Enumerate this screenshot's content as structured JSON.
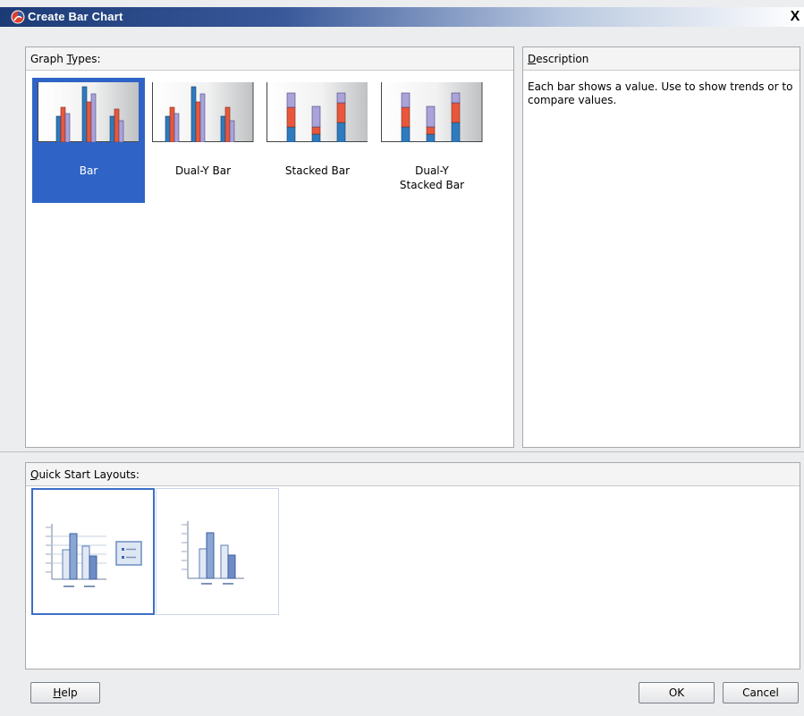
{
  "window": {
    "title": "Create Bar Chart",
    "close_glyph": "X"
  },
  "graph_types": {
    "header": "Graph Types:",
    "mnemonic": "T",
    "items": [
      {
        "label": "Bar",
        "selected": true
      },
      {
        "label": "Dual-Y Bar",
        "selected": false
      },
      {
        "label": "Stacked Bar",
        "selected": false
      },
      {
        "label": "Dual-Y Stacked Bar",
        "selected": false
      }
    ]
  },
  "description": {
    "header": "Description",
    "mnemonic": "D",
    "text": "Each bar shows a value. Use to show trends or to compare values."
  },
  "quick_start": {
    "header": "Quick Start Layouts:",
    "mnemonic": "Q",
    "items": [
      {
        "name": "layout-with-legend",
        "selected": true
      },
      {
        "name": "layout-without-legend",
        "selected": false
      }
    ]
  },
  "buttons": {
    "help": "Help",
    "ok": "OK",
    "cancel": "Cancel"
  },
  "colors": {
    "selection": "#2f64c6",
    "bar_blue": "#2e7bbf",
    "bar_red": "#e8573c",
    "bar_lavender": "#a9a3d9",
    "title_bar": "#1c3b76"
  }
}
